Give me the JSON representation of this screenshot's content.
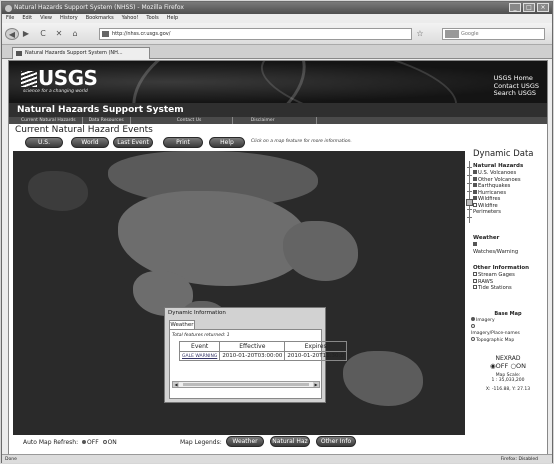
{
  "browser": {
    "window_title": "Natural Hazards Support System (NHSS) - Mozilla Firefox",
    "menu": [
      "File",
      "Edit",
      "View",
      "History",
      "Bookmarks",
      "Yahoo!",
      "Tools",
      "Help"
    ],
    "url": "http://nhss.cr.usgs.gov/",
    "search_placeholder": "Google",
    "tab_label": "Natural Hazards Support System (NH...",
    "status_left": "Done",
    "status_right": "Firefox: Disabled"
  },
  "header": {
    "logo": "USGS",
    "tagline": "science for a changing world",
    "links": [
      "USGS Home",
      "Contact USGS",
      "Search USGS"
    ],
    "site_title": "Natural Hazards Support System",
    "nav": [
      "Current Natural Hazards",
      "Data Resources",
      "Contact Us",
      "Disclaimer"
    ]
  },
  "page": {
    "heading": "Current Natural Hazard Events",
    "buttons": [
      "U.S.",
      "World",
      "Last Event",
      "Print",
      "Help"
    ],
    "hint": "Click on a map feature for more information."
  },
  "dynamic_data": {
    "title": "Dynamic Data",
    "natural_hazards": {
      "head": "Natural Hazards",
      "items": [
        {
          "label": "U.S. Volcanoes",
          "checked": true
        },
        {
          "label": "Other Volcanoes",
          "checked": true
        },
        {
          "label": "Earthquakes",
          "checked": true
        },
        {
          "label": "Hurricanes",
          "checked": true
        },
        {
          "label": "Wildfires",
          "checked": true
        },
        {
          "label": "Wildfire Perimeters",
          "checked": false
        }
      ]
    },
    "weather": {
      "head": "Weather",
      "items": [
        {
          "label": "Watches/Warning",
          "checked": true
        }
      ]
    },
    "other": {
      "head": "Other Information",
      "items": [
        {
          "label": "Stream Gages",
          "checked": false
        },
        {
          "label": "RAWS",
          "checked": false
        },
        {
          "label": "Tide Stations",
          "checked": false
        }
      ]
    },
    "base_map": {
      "head": "Base Map",
      "options": [
        {
          "label": "Imagery",
          "selected": true
        },
        {
          "label": "Imagery/Place-names",
          "selected": false
        },
        {
          "label": "Topographic Map",
          "selected": false
        }
      ]
    },
    "nexrad": {
      "head": "NEXRAD",
      "off": "OFF",
      "on": "ON",
      "selected": "OFF",
      "scale_label": "Map Scale:",
      "scale_value": "1 : 35,033,200",
      "coords": "X: -116.88, Y: 27.13"
    }
  },
  "popup": {
    "title": "Dynamic Information",
    "tab": "Weather",
    "count": "Total features returned: 1",
    "columns": [
      "Event",
      "Effective",
      "Expires"
    ],
    "rows": [
      {
        "event": "GALE WARNING",
        "effective": "2010-01-20T03:00:00",
        "expires": "2010-01-20T11:30:0"
      }
    ]
  },
  "bottom": {
    "refresh_label": "Auto Map Refresh:",
    "off": "OFF",
    "on": "ON",
    "legends_label": "Map Legends:",
    "legend_buttons": [
      "Weather",
      "Natural Haz",
      "Other Info"
    ]
  }
}
